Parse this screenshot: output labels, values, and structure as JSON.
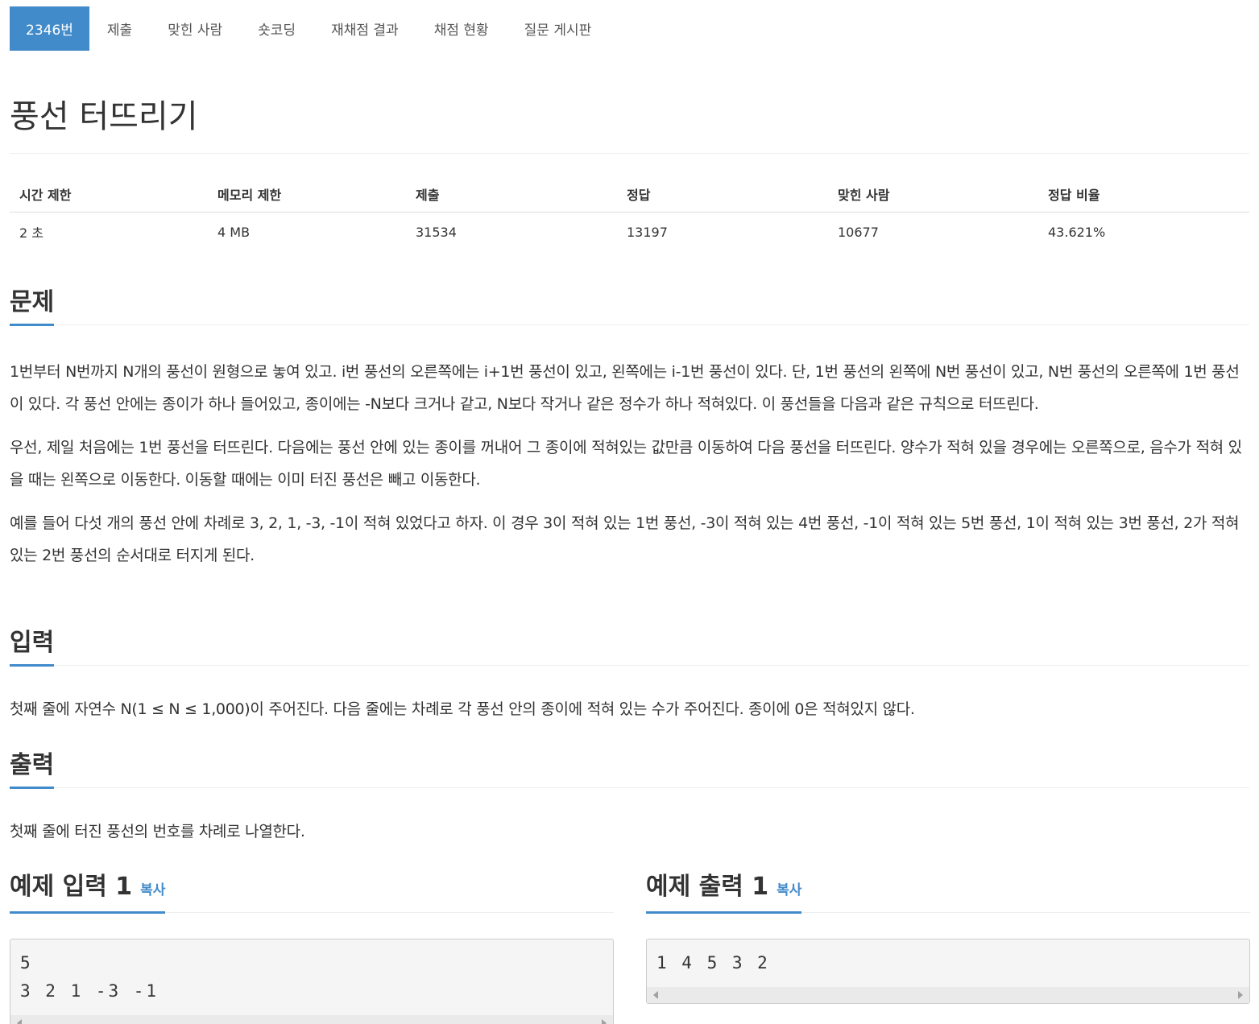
{
  "tabs": [
    {
      "label": "2346번",
      "active": true
    },
    {
      "label": "제출"
    },
    {
      "label": "맞힌 사람"
    },
    {
      "label": "숏코딩"
    },
    {
      "label": "재채점 결과"
    },
    {
      "label": "채점 현황"
    },
    {
      "label": "질문 게시판"
    }
  ],
  "title": "풍선 터뜨리기",
  "info": {
    "headers": [
      "시간 제한",
      "메모리 제한",
      "제출",
      "정답",
      "맞힌 사람",
      "정답 비율"
    ],
    "values": [
      "2 초",
      "4 MB",
      "31534",
      "13197",
      "10677",
      "43.621%"
    ]
  },
  "problem": {
    "title": "문제",
    "paragraphs": [
      "1번부터 N번까지 N개의 풍선이 원형으로 놓여 있고. i번 풍선의 오른쪽에는 i+1번 풍선이 있고, 왼쪽에는 i-1번 풍선이 있다. 단, 1번 풍선의 왼쪽에 N번 풍선이 있고, N번 풍선의 오른쪽에 1번 풍선이 있다. 각 풍선 안에는 종이가 하나 들어있고, 종이에는 -N보다 크거나 같고, N보다 작거나 같은 정수가 하나 적혀있다. 이 풍선들을 다음과 같은 규칙으로 터뜨린다.",
      "우선, 제일 처음에는 1번 풍선을 터뜨린다. 다음에는 풍선 안에 있는 종이를 꺼내어 그 종이에 적혀있는 값만큼 이동하여 다음 풍선을 터뜨린다. 양수가 적혀 있을 경우에는 오른쪽으로, 음수가 적혀 있을 때는 왼쪽으로 이동한다. 이동할 때에는 이미 터진 풍선은 빼고 이동한다.",
      "예를 들어 다섯 개의 풍선 안에 차례로 3, 2, 1, -3, -1이 적혀 있었다고 하자. 이 경우 3이 적혀 있는 1번 풍선, -3이 적혀 있는 4번 풍선, -1이 적혀 있는 5번 풍선, 1이 적혀 있는 3번 풍선, 2가 적혀 있는 2번 풍선의 순서대로 터지게 된다."
    ]
  },
  "input": {
    "title": "입력",
    "text": "첫째 줄에 자연수 N(1 ≤ N ≤ 1,000)이 주어진다. 다음 줄에는 차례로 각 풍선 안의 종이에 적혀 있는 수가 주어진다. 종이에 0은 적혀있지 않다."
  },
  "output": {
    "title": "출력",
    "text": "첫째 줄에 터진 풍선의 번호를 차례로 나열한다."
  },
  "sample_input": {
    "title": "예제 입력 1",
    "copy_label": "복사",
    "content": "5\n3 2 1 -3 -1"
  },
  "sample_output": {
    "title": "예제 출력 1",
    "copy_label": "복사",
    "content": "1 4 5 3 2"
  }
}
